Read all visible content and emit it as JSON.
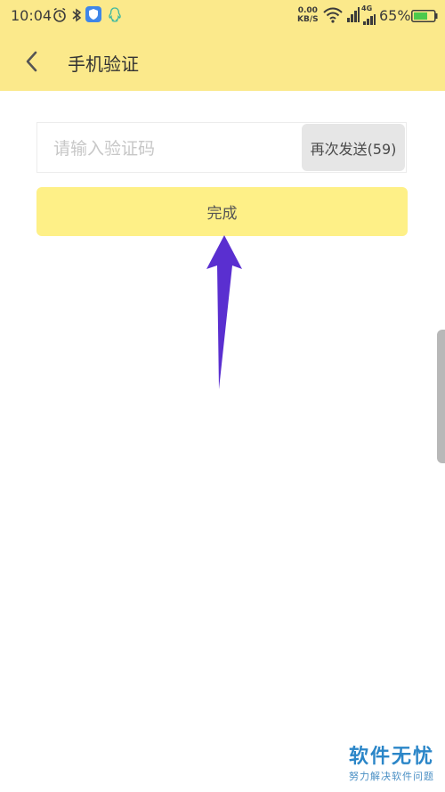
{
  "status_bar": {
    "time": "10:04",
    "net_speed_value": "0.00",
    "net_speed_unit": "KB/S",
    "network_label": "4G",
    "battery_percent": "65%"
  },
  "header": {
    "title": "手机验证",
    "background_color": "#fbe98b"
  },
  "form": {
    "code_input_placeholder": "请输入验证码",
    "code_input_value": "",
    "resend_label": "再次发送(59)",
    "submit_label": "完成"
  },
  "annotation": {
    "arrow_color": "#5a2fd0"
  },
  "watermark": {
    "title": "软件无忧",
    "subtitle": "努力解决软件问题"
  }
}
